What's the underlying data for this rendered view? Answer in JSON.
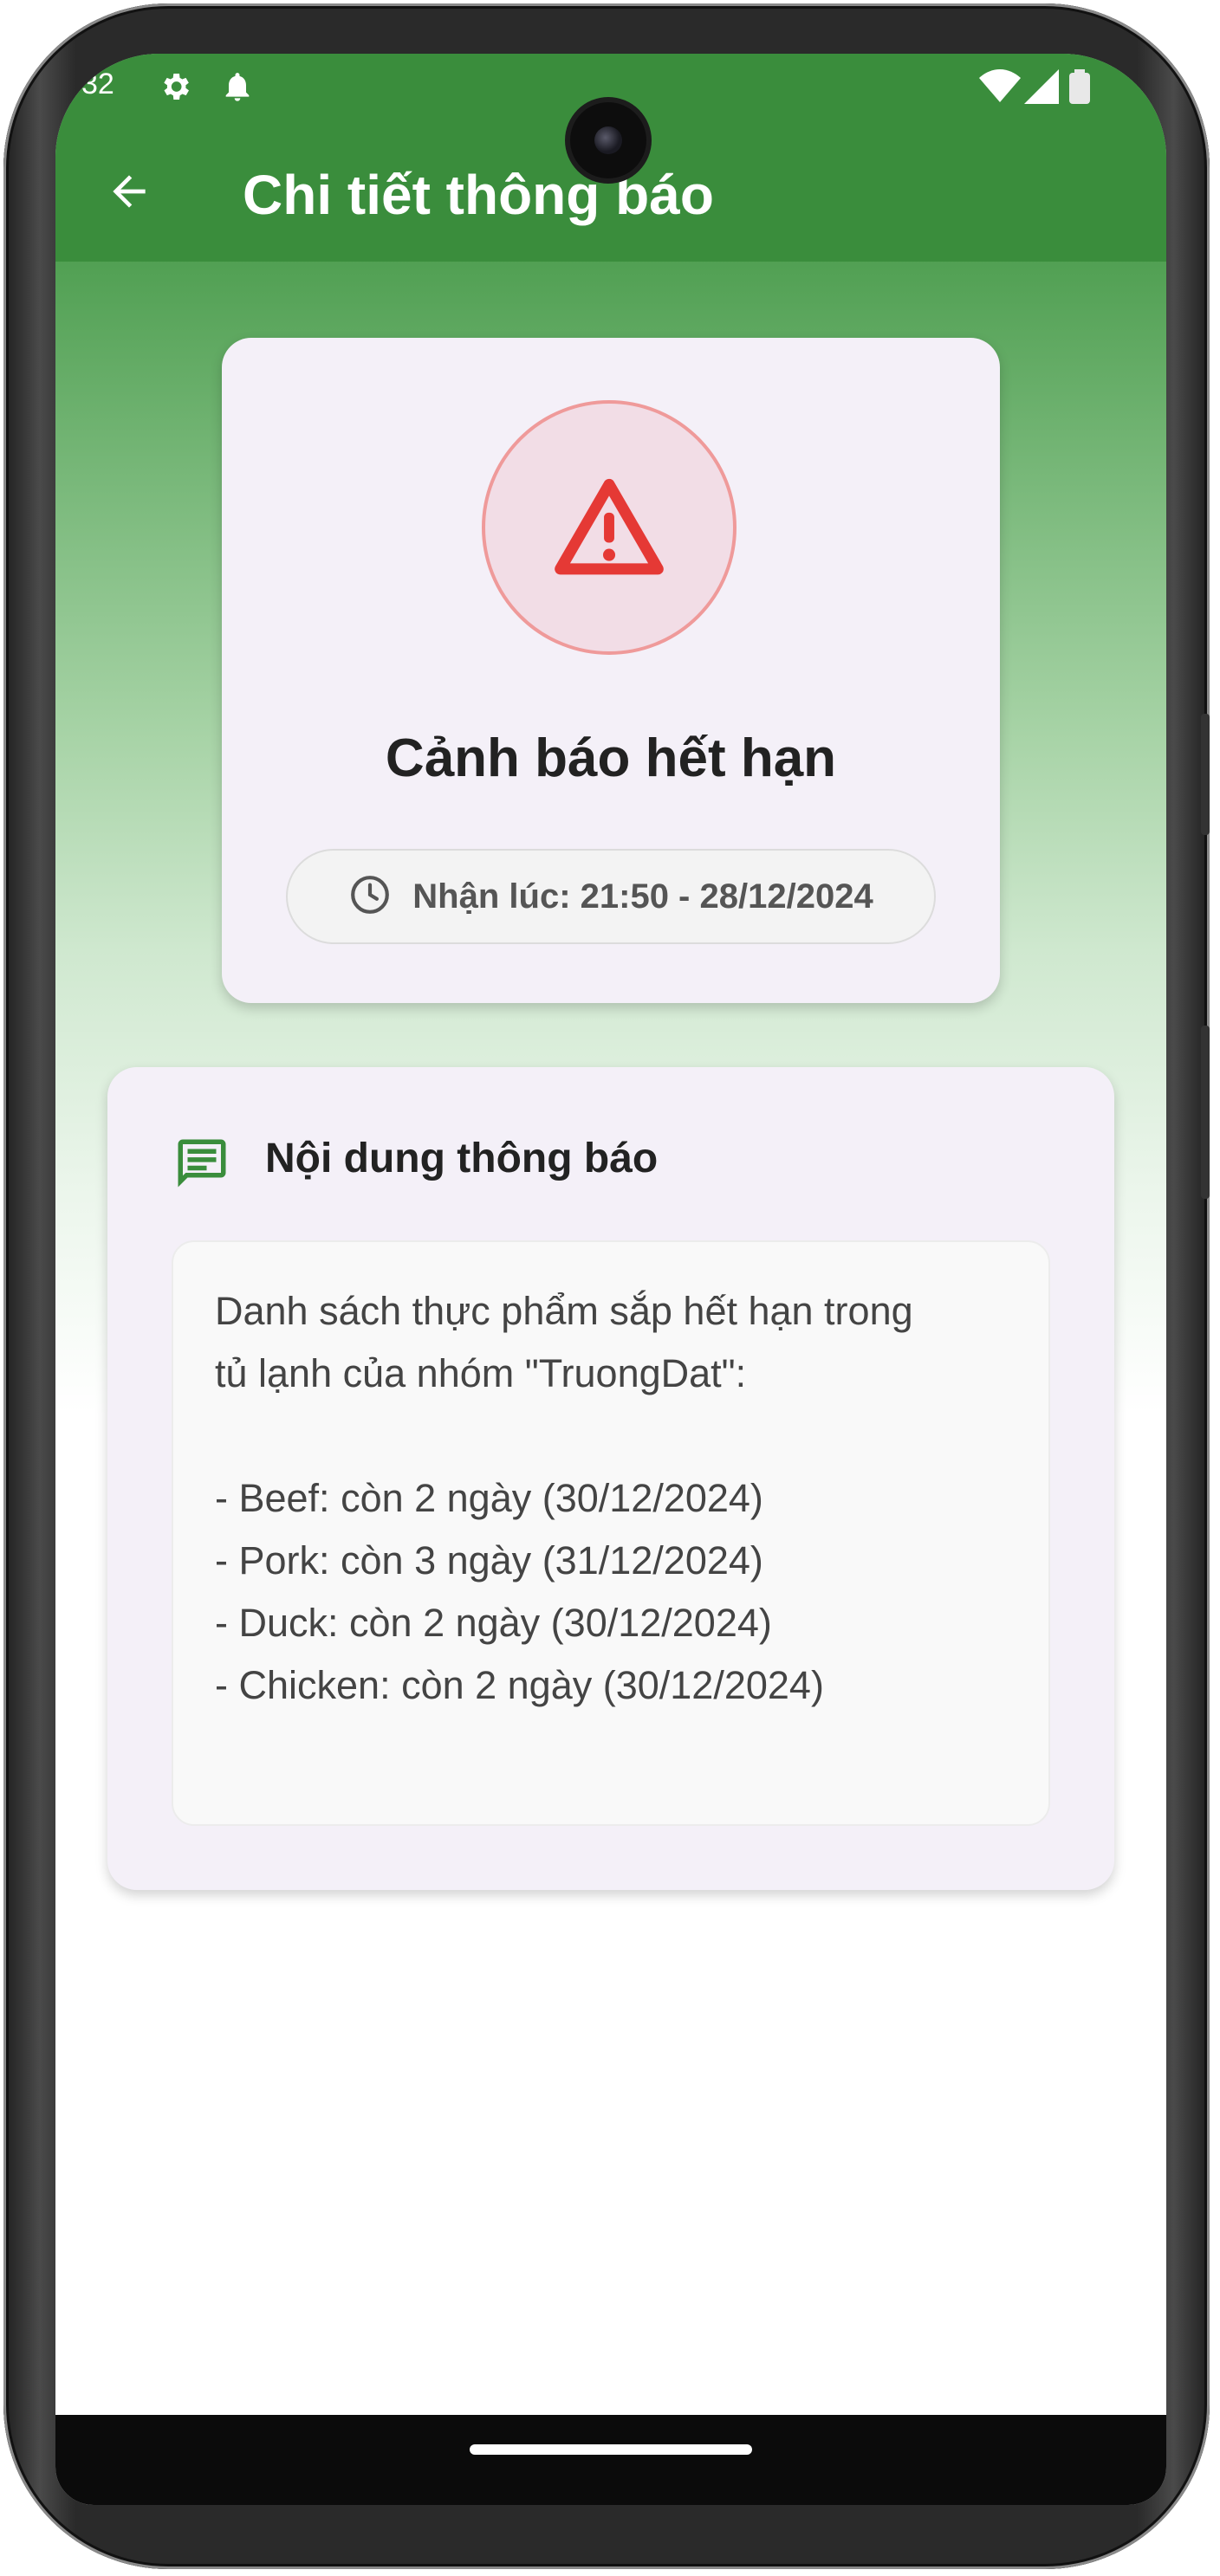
{
  "status_bar": {
    "time": "32",
    "icons": [
      "gear-icon",
      "bell-icon",
      "wifi-icon",
      "signal-icon",
      "battery-icon"
    ]
  },
  "app_bar": {
    "title": "Chi tiết thông báo",
    "back_icon": "arrow-left-icon",
    "color": "#3a8d3c"
  },
  "alert": {
    "icon": "warning-triangle-icon",
    "title": "Cảnh báo hết hạn",
    "received_label": "Nhận lúc: 21:50 - 28/12/2024",
    "accent": "#e53935"
  },
  "content": {
    "section_title": "Nội dung thông báo",
    "section_icon": "message-icon",
    "lines": [
      "Danh sách thực phẩm sắp hết hạn trong",
      "tủ lạnh của nhóm \"TruongDat\":",
      "- Beef: còn 2 ngày (30/12/2024)",
      "- Pork: còn 3 ngày (31/12/2024)",
      "- Duck: còn 2 ngày (30/12/2024)",
      "- Chicken: còn 2 ngày (30/12/2024)"
    ]
  }
}
